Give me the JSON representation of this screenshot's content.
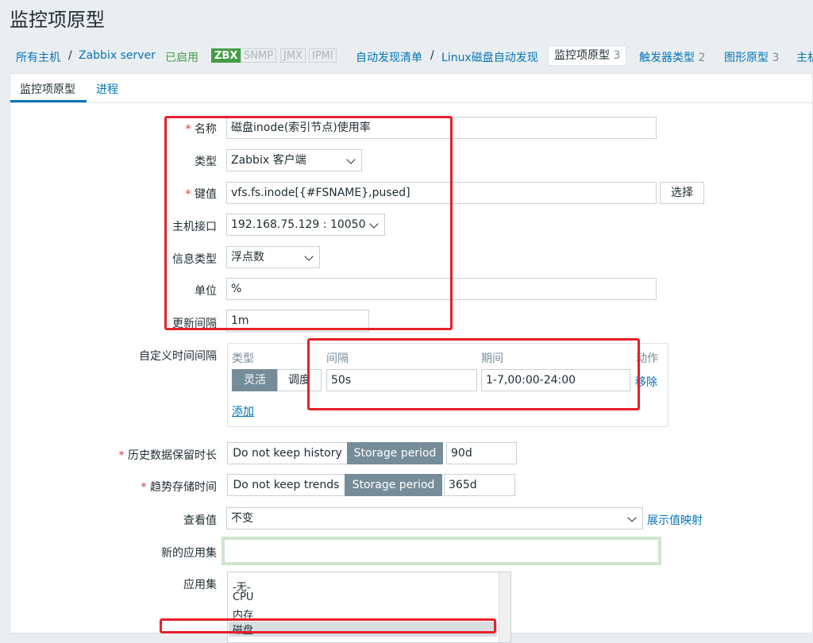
{
  "page_title": "监控项原型",
  "breadcrumb": {
    "all_hosts": "所有主机",
    "sep": "/",
    "host": "Zabbix server",
    "status": "已启用",
    "tags": [
      "ZBX",
      "SNMP",
      "JMX",
      "IPMI"
    ],
    "discovery_list": "自动发现清单",
    "discovery_rule": "Linux磁盘自动发现",
    "item_proto": {
      "label": "监控项原型",
      "count": "3"
    },
    "trigger_proto": {
      "label": "触发器类型",
      "count": "2"
    },
    "graph_proto": {
      "label": "图形原型",
      "count": "3"
    },
    "host_proto": "主机"
  },
  "tabs": {
    "item": "监控项原型",
    "process": "进程"
  },
  "form": {
    "required_mark": "*",
    "name": {
      "label": "名称",
      "value": "磁盘inode(索引节点)使用率"
    },
    "type": {
      "label": "类型",
      "value": "Zabbix 客户端"
    },
    "key": {
      "label": "键值",
      "value": "vfs.fs.inode[{#FSNAME},pused]",
      "select_button": "选择"
    },
    "interface": {
      "label": "主机接口",
      "value": "192.168.75.129 : 10050"
    },
    "info_type": {
      "label": "信息类型",
      "value": "浮点数"
    },
    "units": {
      "label": "单位",
      "value": "%"
    },
    "update_interval": {
      "label": "更新间隔",
      "value": "1m"
    },
    "custom_intervals": {
      "label": "自定义时间间隔",
      "headers": {
        "type": "类型",
        "interval": "间隔",
        "period": "期间",
        "action": "动作"
      },
      "row": {
        "flexible": "灵活",
        "scheduling": "调度",
        "interval": "50s",
        "period": "1-7,00:00-24:00",
        "remove": "移除"
      },
      "add": "添加"
    },
    "history": {
      "label": "历史数据保留时长",
      "no_keep": "Do not keep history",
      "storage": "Storage period",
      "value": "90d"
    },
    "trends": {
      "label": "趋势存储时间",
      "no_keep": "Do not keep trends",
      "storage": "Storage period",
      "value": "365d"
    },
    "show_value": {
      "label": "查看值",
      "value": "不变",
      "link": "展示值映射"
    },
    "new_application": {
      "label": "新的应用集",
      "value": ""
    },
    "applications": {
      "label": "应用集",
      "items": [
        "-无-",
        "CPU",
        "内存",
        "磁盘"
      ]
    }
  },
  "colors": {
    "accent": "#0275b8",
    "enabled": "#429e47",
    "highlight_box": "#e8202a",
    "toggle_active": "#768d99"
  }
}
